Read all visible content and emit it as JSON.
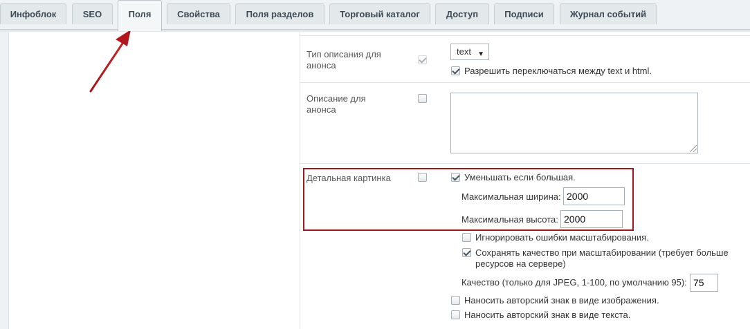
{
  "tabs": [
    {
      "label": "Инфоблок",
      "active": false
    },
    {
      "label": "SEO",
      "active": false
    },
    {
      "label": "Поля",
      "active": true
    },
    {
      "label": "Свойства",
      "active": false
    },
    {
      "label": "Поля разделов",
      "active": false
    },
    {
      "label": "Торговый каталог",
      "active": false
    },
    {
      "label": "Доступ",
      "active": false
    },
    {
      "label": "Подписи",
      "active": false
    },
    {
      "label": "Журнал событий",
      "active": false
    }
  ],
  "fields": {
    "preview_text_type": {
      "label_line1": "Тип описания для",
      "label_line2": "анонса",
      "select_value": "text",
      "allow_switch_label": "Разрешить переключаться между text и html."
    },
    "preview_text": {
      "label_line1": "Описание для",
      "label_line2": "анонса",
      "textarea_value": ""
    },
    "detail_picture": {
      "label": "Детальная картинка",
      "resize_label": "Уменьшать если большая.",
      "max_width_label": "Максимальная ширина:",
      "max_width_value": "2000",
      "max_height_label": "Максимальная высота:",
      "max_height_value": "2000",
      "ignore_errors_label": "Игнорировать ошибки масштабирования.",
      "keep_quality_line1": "Сохранять качество при масштабировании (требует больше",
      "keep_quality_line2": "ресурсов на сервере)",
      "quality_label": "Качество (только для JPEG, 1-100, по умолчанию 95):",
      "quality_value": "75",
      "watermark_image_label": "Наносить авторский знак в виде изображения.",
      "watermark_text_label": "Наносить авторский знак в виде текста."
    }
  },
  "colors": {
    "highlight_border": "#a0171e",
    "annotation_arrow": "#b3171e"
  },
  "icons": {
    "select_arrow": "▼",
    "annotation": "red-arrow-icon"
  }
}
